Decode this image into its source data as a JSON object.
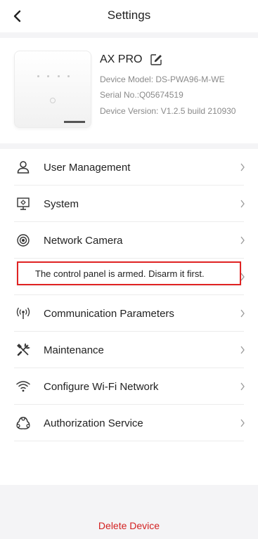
{
  "header": {
    "title": "Settings",
    "back_icon": "chevron-left-icon"
  },
  "device": {
    "name": "AX PRO",
    "model": "Device Model: DS-PWA96-M-WE",
    "serial": "Serial No.:Q05674519",
    "version": "Device Version: V1.2.5 build 210930"
  },
  "menu": {
    "items": [
      {
        "label": "User Management",
        "icon": "user-icon"
      },
      {
        "label": "System",
        "icon": "system-icon"
      },
      {
        "label": "Network Camera",
        "icon": "camera-icon"
      },
      {
        "label": "",
        "icon": "hidden-icon"
      },
      {
        "label": "Communication Parameters",
        "icon": "signal-icon"
      },
      {
        "label": "Maintenance",
        "icon": "tools-icon"
      },
      {
        "label": "Configure Wi-Fi Network",
        "icon": "wifi-icon"
      },
      {
        "label": "Authorization Service",
        "icon": "authorization-icon"
      }
    ]
  },
  "toast": {
    "message": "The control panel is armed. Disarm it first."
  },
  "footer": {
    "delete_label": "Delete Device"
  },
  "colors": {
    "accent": "#d32222",
    "toast_border": "#e02323",
    "background": "#f4f4f6"
  }
}
